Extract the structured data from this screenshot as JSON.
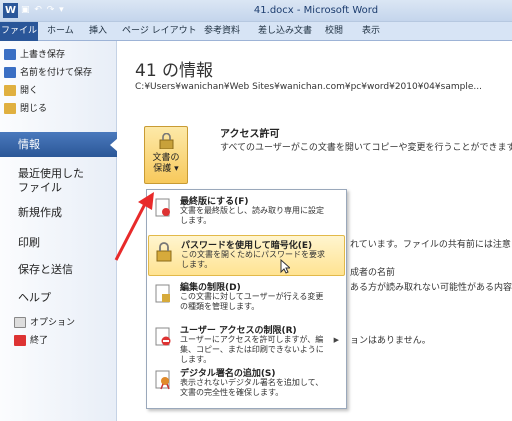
{
  "window": {
    "title": "41.docx - Microsoft Word",
    "logo": "W",
    "qat": "▣ ↶ ↷ ▾"
  },
  "tabs": [
    "ファイル",
    "ホーム",
    "挿入",
    "ページ レイアウト",
    "参考資料",
    "差し込み文書",
    "校閲",
    "表示"
  ],
  "commands": [
    {
      "label": "上書き保存",
      "icon": "save-icon",
      "color": "#3a6fc4"
    },
    {
      "label": "名前を付けて保存",
      "icon": "save-as-icon",
      "color": "#3a6fc4"
    },
    {
      "label": "開く",
      "icon": "open-folder-icon",
      "color": "#e0b040"
    },
    {
      "label": "閉じる",
      "icon": "close-folder-icon",
      "color": "#e0b040"
    }
  ],
  "nav": {
    "info": "情報",
    "recent1": "最近使用した",
    "recent2": "ファイル",
    "new": "新規作成",
    "print": "印刷",
    "share": "保存と送信",
    "help": "ヘルプ",
    "options": "オプション",
    "exit": "終了"
  },
  "main": {
    "title": "41 の情報",
    "path": "C:¥Users¥wanichan¥Web Sites¥wanichan.com¥pc¥word¥2010¥04¥sample...",
    "protect_label1": "文書の",
    "protect_label2": "保護",
    "perm_title": "アクセス許可",
    "perm_desc": "すべてのユーザーがこの文書を開いてコピーや変更を行うことができます。"
  },
  "background": {
    "t1": "れています。ファイルの共有前には注意してく",
    "t2": "成者の名前",
    "t3": "ある方が読み取れない可能性がある内容",
    "t4": "ョンはありません。"
  },
  "menu": [
    {
      "title": "最終版にする(F)",
      "desc": "文書を最終版とし、読み取り専用に設定します。",
      "icon": "mark-final-icon"
    },
    {
      "title": "パスワードを使用して暗号化(E)",
      "desc": "この文書を開くためにパスワードを要求します。",
      "icon": "encrypt-lock-icon"
    },
    {
      "title": "編集の制限(D)",
      "desc": "この文書に対してユーザーが行える変更の種類を管理します。",
      "icon": "restrict-editing-icon"
    },
    {
      "title": "ユーザー アクセスの制限(R)",
      "desc": "ユーザーにアクセスを許可しますが、編集、コピー、または印刷できないようにします。",
      "icon": "restrict-access-icon"
    },
    {
      "title": "デジタル署名の追加(S)",
      "desc": "表示されないデジタル署名を追加して、文書の完全性を確保します。",
      "icon": "digital-signature-icon"
    }
  ]
}
